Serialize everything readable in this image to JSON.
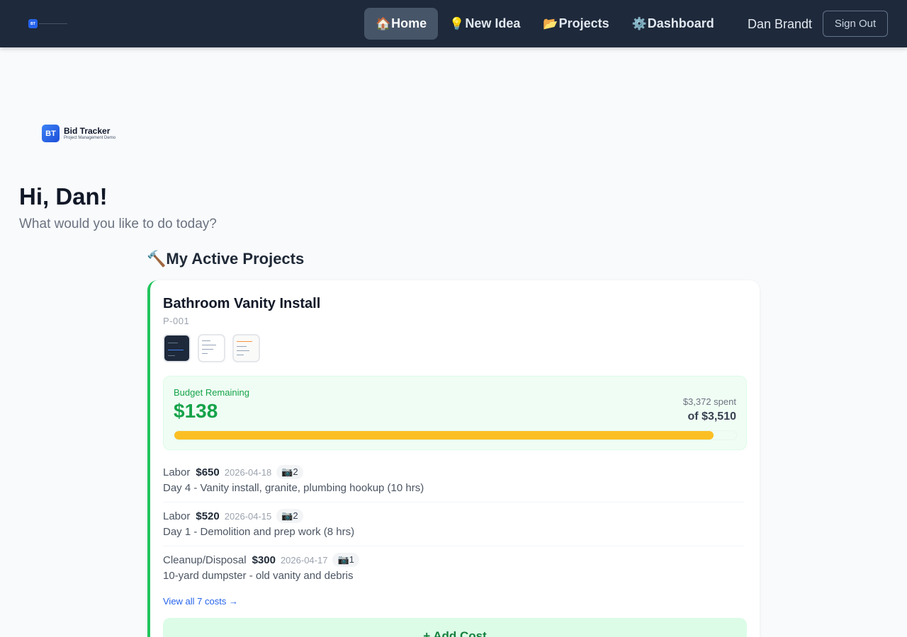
{
  "nav": {
    "logo_badge": "BT",
    "items": [
      {
        "icon": "🏠",
        "label": "Home"
      },
      {
        "icon": "💡",
        "label": "New Idea"
      },
      {
        "icon": "📂",
        "label": "Projects"
      },
      {
        "icon": "⚙️",
        "label": "Dashboard"
      }
    ],
    "user": "Dan Brandt",
    "sign_out": "Sign Out"
  },
  "brand": {
    "badge": "BT",
    "name": "Bid Tracker",
    "tagline": "Project Management Demo"
  },
  "greeting": {
    "title": "Hi, Dan!",
    "subtitle": "What would you like to do today?"
  },
  "section": {
    "icon": "🔨",
    "title": "My Active Projects"
  },
  "project": {
    "title": "Bathroom Vanity Install",
    "id": "P-001",
    "budget": {
      "label": "Budget Remaining",
      "remaining": "$138",
      "spent": "$3,372 spent",
      "total": "of $3,510",
      "spent_fraction": 0.96
    },
    "costs": [
      {
        "category": "Labor",
        "amount": "$650",
        "date": "2026-04-18",
        "photos": "📷2",
        "description": "Day 4 - Vanity install, granite, plumbing hookup (10 hrs)"
      },
      {
        "category": "Labor",
        "amount": "$520",
        "date": "2026-04-15",
        "photos": "📷2",
        "description": "Day 1 - Demolition and prep work (8 hrs)"
      },
      {
        "category": "Cleanup/Disposal",
        "amount": "$300",
        "date": "2026-04-17",
        "photos": "📷1",
        "description": "10-yard dumpster - old vanity and debris"
      }
    ],
    "view_all": "View all 7 costs →",
    "add_cost": "+ Add Cost"
  },
  "colors": {
    "nav_bg": "#1e293b",
    "accent_green": "#16a34a",
    "progress": "#fbbf24",
    "link": "#2563eb"
  }
}
